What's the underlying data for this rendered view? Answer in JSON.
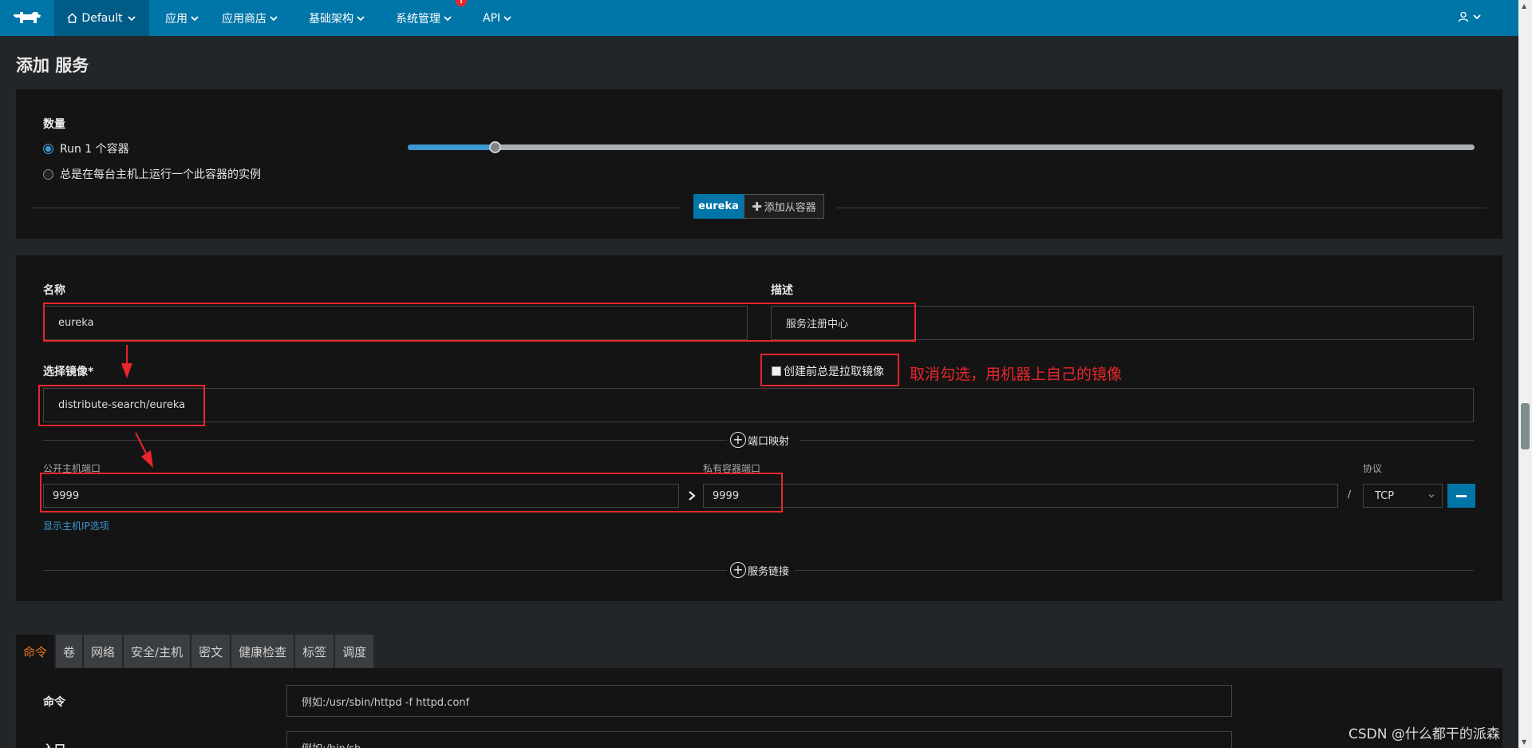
{
  "nav": {
    "env_label": "Default",
    "items": [
      {
        "label": "应用"
      },
      {
        "label": "应用商店"
      },
      {
        "label": "基础架构"
      },
      {
        "label": "系统管理"
      },
      {
        "label": "API"
      }
    ],
    "alert_badge": "!"
  },
  "page_title": "添加 服务",
  "scale": {
    "label": "数量",
    "option_run": "Run 1 个容器",
    "option_global": "总是在每台主机上运行一个此容器的实例",
    "slider_fraction": 0.082
  },
  "containers": {
    "active_tab": "eureka",
    "add_sidekick": "添加从容器"
  },
  "form": {
    "name_label": "名称",
    "name_value": "eureka",
    "desc_label": "描述",
    "desc_value": "服务注册中心",
    "image_label": "选择镜像*",
    "image_value": "distribute-search/eureka",
    "pull_checkbox": "创建前总是拉取镜像",
    "annotation": "取消勾选，用机器上自己的镜像"
  },
  "ports": {
    "section": "端口映射",
    "public_label": "公开主机端口",
    "private_label": "私有容器端口",
    "protocol_label": "协议",
    "public_value": "9999",
    "private_value": "9999",
    "separator": "/",
    "protocol_value": "TCP",
    "show_ip_link": "显示主机IP选项"
  },
  "links_section": "服务链接",
  "tabs": [
    "命令",
    "卷",
    "网络",
    "安全/主机",
    "密文",
    "健康检查",
    "标签",
    "调度"
  ],
  "command": {
    "command_label": "命令",
    "command_placeholder": "例如:/usr/sbin/httpd -f httpd.conf",
    "entry_label": "入口",
    "entry_placeholder": "例如:/bin/sh"
  },
  "watermark": "CSDN @什么都干的派森",
  "colors": {
    "nav_blue": "#0075a8",
    "annotation_red": "#e8262b",
    "active_tab_orange": "#e87722"
  }
}
